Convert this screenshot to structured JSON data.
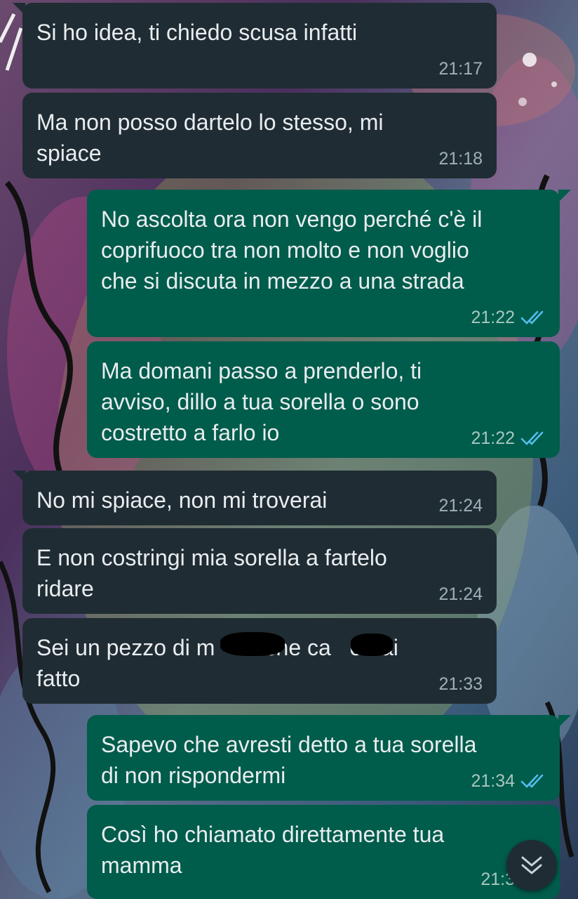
{
  "colors": {
    "incoming_bubble": "#202c33",
    "outgoing_bubble": "#005c4b",
    "read_ticks": "#53bdeb",
    "text": "#e9edef"
  },
  "messages": [
    {
      "direction": "in",
      "text": "Si ho idea, ti chiedo scusa infatti",
      "time": "21:17"
    },
    {
      "direction": "in",
      "text": "Ma non posso dartelo lo stesso, mi\nspiace",
      "time": "21:18"
    },
    {
      "direction": "out",
      "text": "No ascolta ora non vengo perché c'è il\ncoprifuoco tra non molto e non voglio\nche si discuta in mezzo a una strada",
      "time": "21:22",
      "status": "read"
    },
    {
      "direction": "out",
      "text": "Ma domani passo a prenderlo, ti\navviso, dillo a tua sorella o sono\ncostretto a farlo io",
      "time": "21:22",
      "status": "read"
    },
    {
      "direction": "in",
      "text": "No mi spiace, non mi troverai",
      "time": "21:24"
    },
    {
      "direction": "in",
      "text": "E non costringi mia sorella a fartelo\nridare",
      "time": "21:24"
    },
    {
      "direction": "in",
      "text": "Sei un pezzo di m   da che ca   o hai\nfatto",
      "time": "21:33",
      "redacted": true
    },
    {
      "direction": "out",
      "text": "Sapevo che avresti detto a tua sorella\ndi non rispondermi",
      "time": "21:34",
      "status": "read"
    },
    {
      "direction": "out",
      "text": "Così ho chiamato direttamente tua\nmamma",
      "time": "21:3",
      "status": "read"
    }
  ],
  "scroll_button": {
    "icon": "double-chevron-down-icon"
  }
}
